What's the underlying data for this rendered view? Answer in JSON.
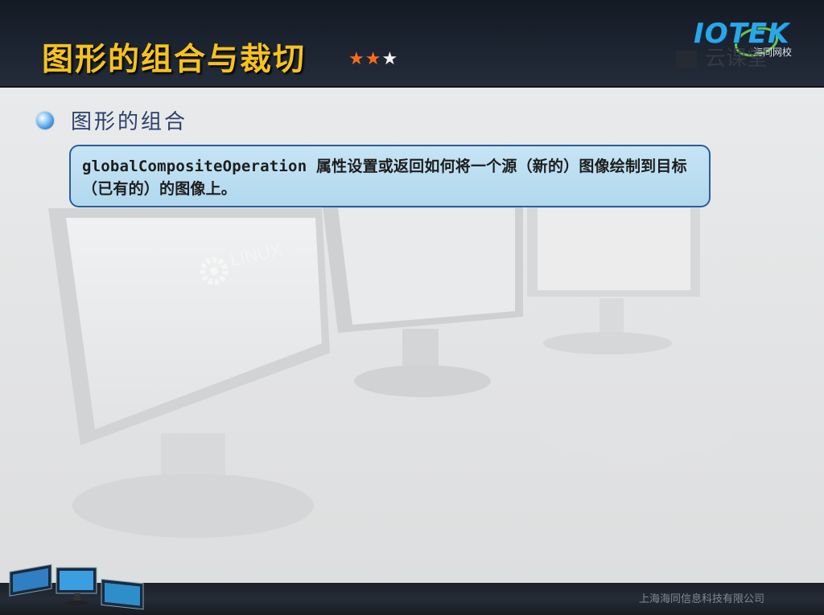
{
  "header": {
    "title": "图形的组合与裁切",
    "stars": {
      "filled": "★★",
      "empty": "★",
      "rating": 2,
      "max": 3
    }
  },
  "logo": {
    "text": "IOTEK",
    "subtitle": "海同网校",
    "icon": "iotek-logo-icon",
    "color": "#2aa7e8"
  },
  "watermark": {
    "text": "云课堂"
  },
  "main": {
    "subtitle": "图形的组合",
    "callout": {
      "text": "globalCompositeOperation 属性设置或返回如何将一个源（新的）图像绘制到目标（已有的）的图像上。"
    },
    "background_label": "LINUX"
  },
  "footer": {
    "company": "上海海同信息科技有限公司",
    "icon": "monitors-icon"
  },
  "colors": {
    "title": "#f7c21c",
    "accent_star": "#ff6a1a",
    "callout_bg": "#b9dcf0",
    "callout_border": "#2d5d9a",
    "subtitle": "#2b3f6b"
  }
}
